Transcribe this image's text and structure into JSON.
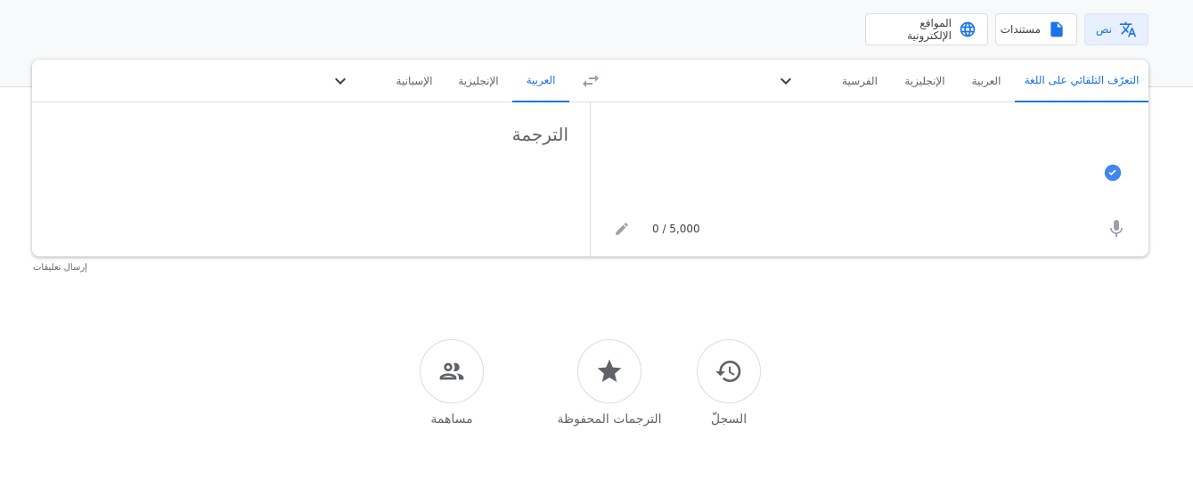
{
  "modes": {
    "text": {
      "label": "نص",
      "icon": "translate-icon"
    },
    "documents": {
      "label": "مستندات",
      "icon": "document-icon"
    },
    "websites": {
      "label": "المواقع الإلكترونية",
      "icon": "globe-icon"
    }
  },
  "source_langs": {
    "detect": "التعرّف التلقائي على اللغة",
    "arabic": "العربية",
    "english": "الإنجليزية",
    "persian": "الفرسية"
  },
  "target_langs": {
    "arabic": "العربية",
    "english": "الإنجليزية",
    "spanish": "الإسبانية"
  },
  "output": {
    "placeholder": "الترجمة"
  },
  "input": {
    "char_counter": "0 / 5,000"
  },
  "feedback": {
    "label": "إرسال تعليقات"
  },
  "bottom": {
    "history": "السجلّ",
    "saved": "الترجمات المحفوظة",
    "contribute": "مساهمة"
  },
  "colors": {
    "accent": "#1a73e8",
    "check": "#4285f4",
    "icon_gray": "#5f6368"
  }
}
